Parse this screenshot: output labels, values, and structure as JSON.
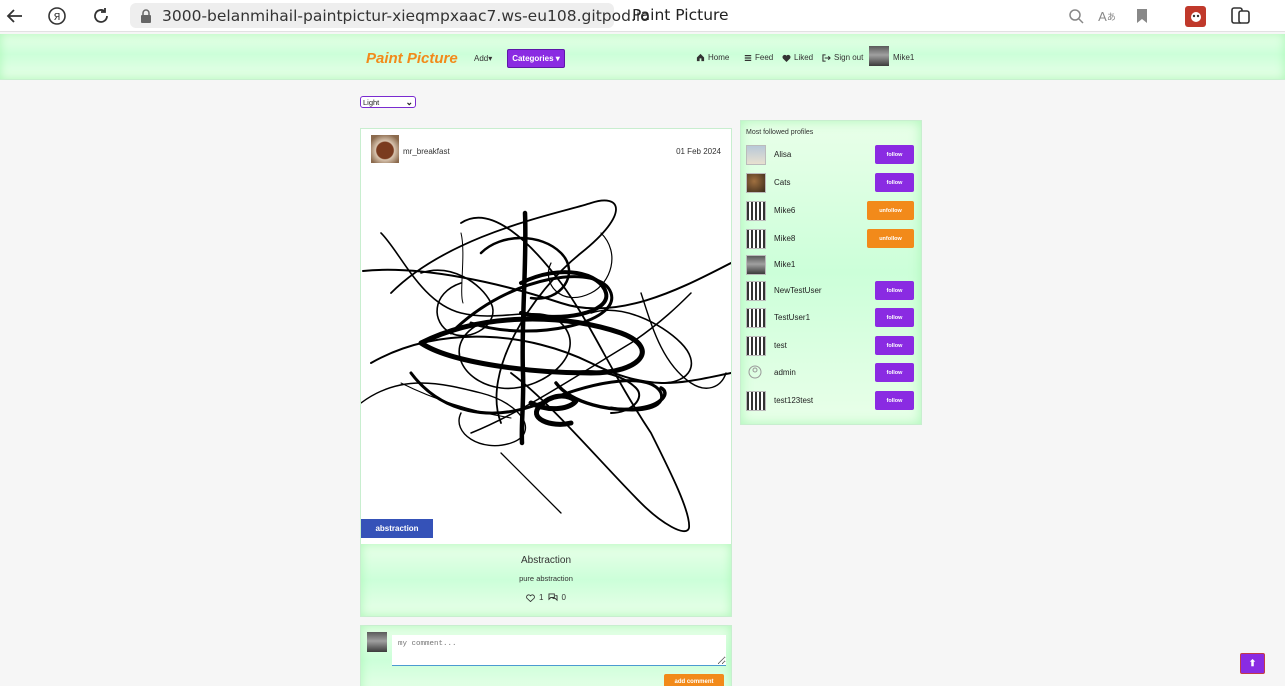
{
  "browser": {
    "url": "3000-belanmihail-paintpictur-xieqmpxaac7.ws-eu108.gitpod.io",
    "tab_title": "Paint Picture",
    "icons": [
      "back-icon",
      "yandex-icon",
      "reload-icon",
      "lock-icon",
      "search-icon",
      "translate-icon",
      "bookmark-icon",
      "extension-icon",
      "profile-icon"
    ]
  },
  "navbar": {
    "brand": "Paint Picture",
    "add_label": "Add",
    "categories_label": "Categories",
    "links": [
      {
        "label": "Home",
        "icon": "home-icon"
      },
      {
        "label": "Feed",
        "icon": "feed-icon"
      },
      {
        "label": "Liked",
        "icon": "heart-icon"
      },
      {
        "label": "Sign out",
        "icon": "sign-out-icon"
      }
    ],
    "username": "Mike1"
  },
  "theme_select": {
    "selected": "Light"
  },
  "post": {
    "author": "mr_breakfast",
    "date": "01 Feb 2024",
    "tag": "abstraction",
    "title": "Abstraction",
    "description": "pure abstraction",
    "likes": "1",
    "comments": "0"
  },
  "comment_form": {
    "placeholder": "my comment...",
    "submit_label": "add comment"
  },
  "profiles": {
    "title": "Most followed profiles",
    "items": [
      {
        "name": "Alisa",
        "action": "follow"
      },
      {
        "name": "Cats",
        "action": "follow"
      },
      {
        "name": "Mike6",
        "action": "unfollow"
      },
      {
        "name": "Mike8",
        "action": "unfollow"
      },
      {
        "name": "Mike1",
        "action": ""
      },
      {
        "name": "NewTestUser",
        "action": "follow"
      },
      {
        "name": "TestUser1",
        "action": "follow"
      },
      {
        "name": "test",
        "action": "follow"
      },
      {
        "name": "admin",
        "action": "follow"
      },
      {
        "name": "test123test",
        "action": "follow"
      }
    ]
  },
  "scroll_top_icon": "arrow-up-icon",
  "colors": {
    "accent_purple": "#8a2be2",
    "accent_orange": "#f28a1a",
    "tag_blue": "#3552b8",
    "panel_green": "#ccffd9"
  }
}
